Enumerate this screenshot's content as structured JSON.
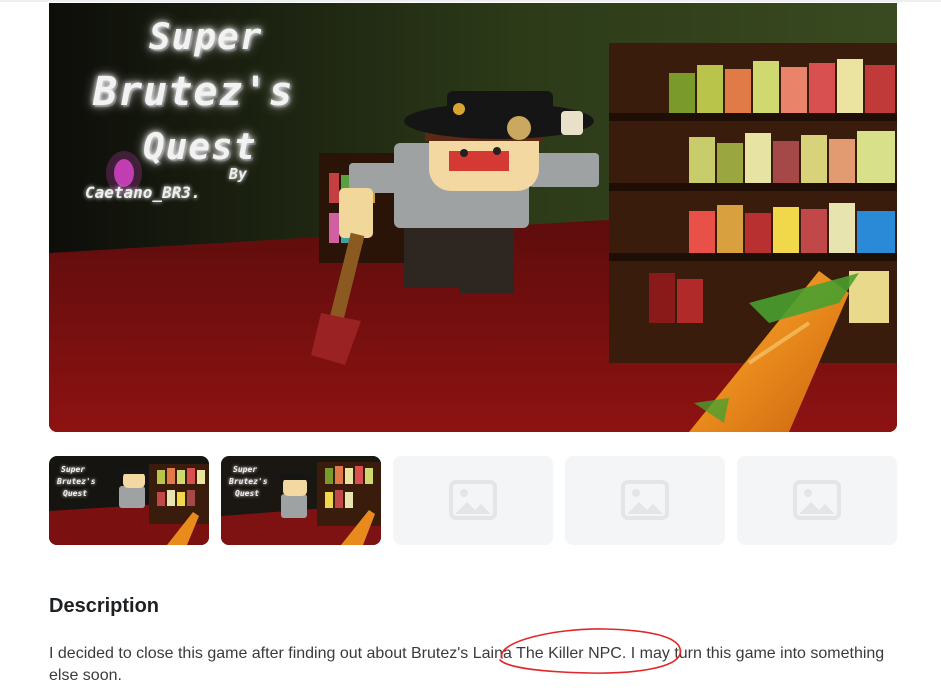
{
  "hero": {
    "title_line_1": "Super",
    "title_line_2": "Brutez's",
    "title_line_3": "Quest",
    "credit_by": "By",
    "credit_name": "Caetano_BR3."
  },
  "thumbnails": [
    {
      "kind": "screenshot",
      "title_lines": [
        "Super",
        "Brutez's",
        "Quest"
      ]
    },
    {
      "kind": "screenshot",
      "title_lines": [
        "Super",
        "Brutez's",
        "Quest"
      ]
    },
    {
      "kind": "placeholder",
      "icon": "image-placeholder-icon"
    },
    {
      "kind": "placeholder",
      "icon": "image-placeholder-icon"
    },
    {
      "kind": "placeholder",
      "icon": "image-placeholder-icon"
    }
  ],
  "description": {
    "heading": "Description",
    "text": "I decided to close this game after finding out about Brutez's Laina The Killer NPC. I may turn this game into something else soon."
  },
  "annotation": {
    "color": "#e0282a"
  },
  "colors": {
    "heading": "#1e2124",
    "body_text": "#393b3d",
    "placeholder_bg": "#f4f5f6",
    "placeholder_icon": "#e3e5e7"
  }
}
